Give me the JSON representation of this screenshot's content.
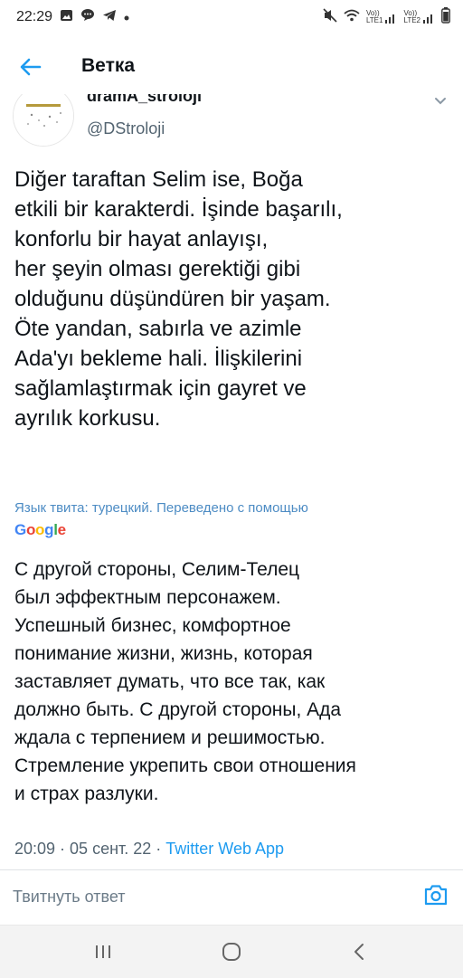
{
  "status_bar": {
    "time": "22:29",
    "left_icons": [
      "gallery-icon",
      "chat-bubble-icon",
      "telegram-icon",
      "dot"
    ],
    "right_icons": [
      "mute-icon",
      "wifi-icon",
      "volte-lte1-signal-icon",
      "volte-lte2-signal-icon",
      "battery-icon"
    ],
    "lte1_label": "LTE1",
    "lte2_label": "LTE2",
    "volte": "Vo))"
  },
  "app_bar": {
    "title": "Ветка",
    "back_icon": "arrow-left-icon"
  },
  "author": {
    "name": "dramA_stroloji",
    "handle": "@DStroloji"
  },
  "tweet": {
    "text": "Diğer taraftan Selim ise, Boğa\netkili bir karakterdi. İşinde başarılı,\nkonforlu bir hayat anlayışı,\nher şeyin olması gerektiği gibi\nolduğunu düşündüren bir yaşam.\nÖte yandan, sabırla ve azimle\nAda'yı bekleme hali. İlişkilerini\nsağlamlaştırmak için gayret ve\nayrılık korkusu.",
    "translation_note": "Язык твита: турецкий. Переведено с помощью",
    "translation_provider": "Google",
    "translated_text": "С другой стороны, Селим-Телец\nбыл эффектным персонажем.\nУспешный бизнес, комфортное\nпонимание жизни, жизнь, которая\nзаставляет думать, что все так, как\nдолжно быть. С другой стороны, Ада\nждала с терпением и решимостью.\nСтремление укрепить свои отношения\nи страх разлуки.",
    "time": "20:09",
    "date": "05 сент. 22",
    "separator": " · ",
    "source": "Twitter Web App"
  },
  "reply": {
    "placeholder": "Твитнуть ответ",
    "camera_icon": "camera-icon"
  },
  "nav": {
    "recents_icon": "recents-icon",
    "home_icon": "home-icon",
    "back_icon": "back-chevron-icon"
  },
  "colors": {
    "link": "#1d9bf0",
    "translate_link": "#4d8cc4",
    "muted": "#536471",
    "text": "#0f1419"
  }
}
